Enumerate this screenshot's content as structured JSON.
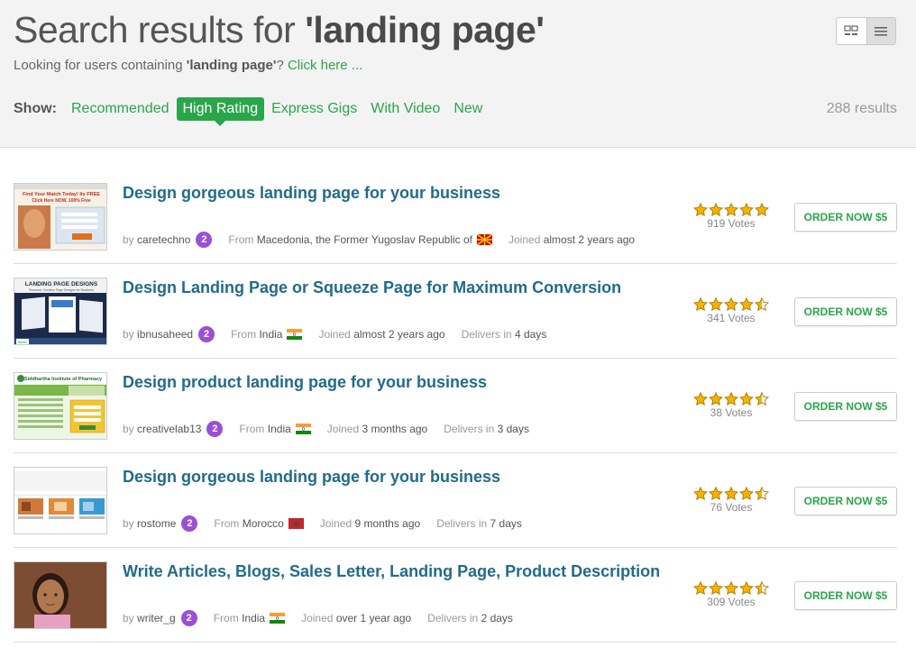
{
  "header": {
    "title_prefix": "Search results for ",
    "title_query": "'landing page'",
    "sub_prefix": "Looking for users containing ",
    "sub_query": "'landing page'",
    "sub_q": "?",
    "sub_link": "Click here ...",
    "show_label": "Show:",
    "filters": [
      "Recommended",
      "High Rating",
      "Express Gigs",
      "With Video",
      "New"
    ],
    "active_filter": "High Rating",
    "results_count": "288 results"
  },
  "gigs": [
    {
      "title": "Design gorgeous landing page for your business",
      "by": "by",
      "seller": "caretechno",
      "level": "2",
      "from_label": "From",
      "country": "Macedonia, the Former Yugoslav Republic of",
      "flag": "macedonia-flag-icon",
      "joined_label": "Joined",
      "joined": "almost 2 years ago",
      "delivers_label": "",
      "delivers": "",
      "stars": 5,
      "votes": "919 Votes",
      "order": "ORDER NOW $5"
    },
    {
      "title": "Design Landing Page or Squeeze Page for Maximum Conversion",
      "by": "by",
      "seller": "ibnusaheed",
      "level": "2",
      "from_label": "From",
      "country": "India",
      "flag": "india-flag-icon",
      "joined_label": "Joined",
      "joined": "almost 2 years ago",
      "delivers_label": "Delivers in",
      "delivers": "4 days",
      "stars": 4.5,
      "votes": "341 Votes",
      "order": "ORDER NOW $5"
    },
    {
      "title": "Design product landing page for your business",
      "by": "by",
      "seller": "creativelab13",
      "level": "2",
      "from_label": "From",
      "country": "India",
      "flag": "india-flag-icon",
      "joined_label": "Joined",
      "joined": "3 months ago",
      "delivers_label": "Delivers in",
      "delivers": "3 days",
      "stars": 4.5,
      "votes": "38 Votes",
      "order": "ORDER NOW $5"
    },
    {
      "title": "Design gorgeous landing page for your business",
      "by": "by",
      "seller": "rostome",
      "level": "2",
      "from_label": "From",
      "country": "Morocco",
      "flag": "morocco-flag-icon",
      "joined_label": "Joined",
      "joined": "9 months ago",
      "delivers_label": "Delivers in",
      "delivers": "7 days",
      "stars": 4.5,
      "votes": "76 Votes",
      "order": "ORDER NOW $5"
    },
    {
      "title": "Write Articles, Blogs, Sales Letter, Landing Page, Product Description",
      "by": "by",
      "seller": "writer_g",
      "level": "2",
      "from_label": "From",
      "country": "India",
      "flag": "india-flag-icon",
      "joined_label": "Joined",
      "joined": "over 1 year ago",
      "delivers_label": "Delivers in",
      "delivers": "2 days",
      "stars": 4.5,
      "votes": "309 Votes",
      "order": "ORDER NOW $5"
    }
  ],
  "thumbnails": [
    {
      "name": "gig-thumbnail-dating",
      "text_top": "Find Your Match Today! Its FREE",
      "text_mid": "Click Here NOW, 100% Free"
    },
    {
      "name": "gig-thumbnail-landing-page-designs",
      "text_top": "LANDING PAGE DESIGNS",
      "text_mid": "Personal, Creative Page Designs for Business",
      "badge": "fiverr"
    },
    {
      "name": "gig-thumbnail-pharmacy",
      "text_top": "Siddhartha Institute of Pharmacy"
    },
    {
      "name": "gig-thumbnail-web-template"
    },
    {
      "name": "gig-thumbnail-portrait"
    }
  ],
  "colors": {
    "accent_green": "#2aa64a",
    "title_blue": "#216b8c",
    "level_purple": "#9b4fd6",
    "star_gold": "#f5b301"
  }
}
